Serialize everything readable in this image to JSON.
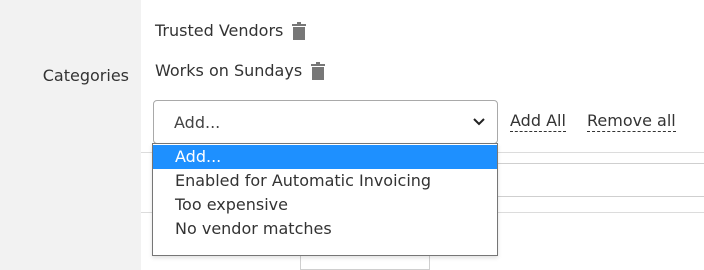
{
  "form": {
    "categories_label": "Categories",
    "tags": [
      {
        "label": "Trusted Vendors"
      },
      {
        "label": "Works on Sundays"
      }
    ],
    "select": {
      "value": "Add...",
      "options": [
        "Add...",
        "Enabled for Automatic Invoicing",
        "Too expensive",
        "No vendor matches"
      ],
      "selected_index": 0
    },
    "actions": {
      "add_all": "Add All",
      "remove_all": "Remove all"
    }
  },
  "colors": {
    "label_column_bg": "#f2f2f2",
    "selected_option_bg": "#1e90ff",
    "trash_icon": "#777777"
  }
}
